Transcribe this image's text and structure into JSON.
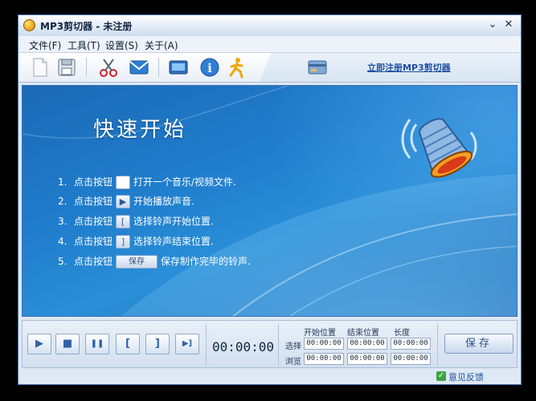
{
  "window": {
    "title": "MP3剪切器 - 未注册",
    "controls": {
      "minimize": "⌄",
      "close": "✕"
    }
  },
  "menu": [
    "文件(F)",
    "工具(T)",
    "设置(S)",
    "关于(A)"
  ],
  "toolbar": {
    "icons": [
      "new-file-icon",
      "save-disk-icon",
      "scissors-icon",
      "email-icon",
      "screen-icon",
      "info-icon",
      "running-man-icon"
    ],
    "register_link": "立即注册MP3剪切器"
  },
  "panel": {
    "title": "快速开始",
    "steps": [
      {
        "num": "1.",
        "pre": "点击按钮",
        "btn": "",
        "post": "打开一个音乐/视频文件."
      },
      {
        "num": "2.",
        "pre": "点击按钮",
        "btn": "▶",
        "post": "开始播放声音."
      },
      {
        "num": "3.",
        "pre": "点击按钮",
        "btn": "[",
        "post": "选择铃声开始位置."
      },
      {
        "num": "4.",
        "pre": "点击按钮",
        "btn": "]",
        "post": "选择铃声结束位置."
      },
      {
        "num": "5.",
        "pre": "点击按钮",
        "btn": "保存",
        "post": "保存制作完毕的铃声."
      }
    ]
  },
  "controls": {
    "buttons": [
      "▶",
      "■",
      "❚❚",
      "[",
      "]",
      "▶]"
    ],
    "time": "00:00:00",
    "columns": [
      "开始位置",
      "结束位置",
      "长度"
    ],
    "rows": [
      {
        "label": "选择",
        "start": "00:00:00",
        "end": "00:00:00",
        "length": "00:00:00"
      },
      {
        "label": "浏览",
        "start": "00:00:00",
        "end": "00:00:00",
        "length": "00:00:00"
      }
    ],
    "save_label": "保存"
  },
  "status": {
    "feedback": "意见反馈"
  }
}
